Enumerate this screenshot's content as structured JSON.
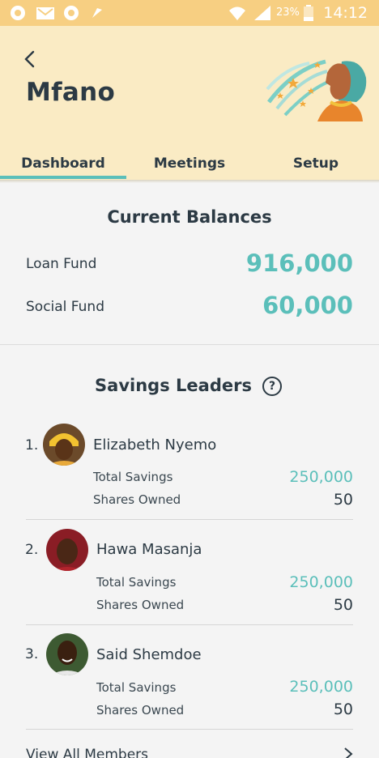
{
  "status_bar": {
    "battery": "23%",
    "time": "14:12",
    "icons": [
      "chrome-icon",
      "gmail-icon",
      "chrome-icon",
      "rocket-icon",
      "wifi-icon",
      "signal-icon",
      "battery-icon"
    ]
  },
  "header": {
    "group_name": "Mfano",
    "tabs": [
      {
        "label": "Dashboard",
        "active": true
      },
      {
        "label": "Meetings",
        "active": false
      },
      {
        "label": "Setup",
        "active": false
      }
    ]
  },
  "balances": {
    "title": "Current Balances",
    "loan_fund_label": "Loan Fund",
    "loan_fund_value": "916,000",
    "social_fund_label": "Social Fund",
    "social_fund_value": "60,000"
  },
  "leaders": {
    "title": "Savings Leaders",
    "total_savings_label": "Total Savings",
    "shares_owned_label": "Shares Owned",
    "items": [
      {
        "rank": "1.",
        "name": "Elizabeth Nyemo",
        "total_savings": "250,000",
        "shares": "50"
      },
      {
        "rank": "2.",
        "name": "Hawa Masanja",
        "total_savings": "250,000",
        "shares": "50"
      },
      {
        "rank": "3.",
        "name": "Said Shemdoe",
        "total_savings": "250,000",
        "shares": "50"
      }
    ],
    "view_all": "View All Members"
  },
  "colors": {
    "accent": "#5bbfba",
    "header_bg": "#faebc4",
    "status_bar_bg": "#f7cf82",
    "text": "#2c3a44"
  }
}
